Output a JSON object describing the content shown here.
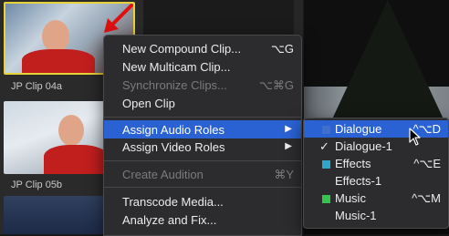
{
  "browser": {
    "clips": [
      {
        "label": "JP Clip 04a"
      },
      {
        "label": "JP Clip 05b"
      }
    ]
  },
  "context_menu": {
    "items": [
      {
        "label": "New Compound Clip...",
        "shortcut": "⌥G",
        "enabled": true
      },
      {
        "label": "New Multicam Clip...",
        "shortcut": "",
        "enabled": true
      },
      {
        "label": "Synchronize Clips...",
        "shortcut": "⌥⌘G",
        "enabled": false
      },
      {
        "label": "Open Clip",
        "shortcut": "",
        "enabled": true
      },
      {
        "label": "Assign Audio Roles",
        "submenu_arrow": "▶",
        "enabled": true,
        "highlighted": true
      },
      {
        "label": "Assign Video Roles",
        "submenu_arrow": "▶",
        "enabled": true
      },
      {
        "label": "Create Audition",
        "shortcut": "⌘Y",
        "enabled": false
      },
      {
        "label": "Transcode Media...",
        "shortcut": "",
        "enabled": true
      },
      {
        "label": "Analyze and Fix...",
        "shortcut": "",
        "enabled": true
      }
    ]
  },
  "audio_roles_submenu": {
    "items": [
      {
        "label": "Dialogue",
        "shortcut": "^⌥D",
        "swatch": "#3f6fc9",
        "highlighted": true
      },
      {
        "label": "Dialogue-1",
        "checked": true,
        "checkmark": "✓"
      },
      {
        "label": "Effects",
        "shortcut": "^⌥E",
        "swatch": "#2fa6c8"
      },
      {
        "label": "Effects-1"
      },
      {
        "label": "Music",
        "shortcut": "^⌥M",
        "swatch": "#35c44e"
      },
      {
        "label": "Music-1"
      }
    ]
  },
  "colors": {
    "highlight": "#2a62d3",
    "clip_selection": "#e8d23a",
    "annotation_arrow": "#e01010"
  }
}
